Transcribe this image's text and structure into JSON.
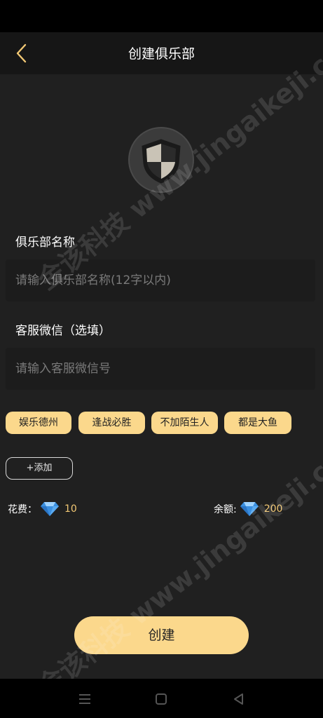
{
  "header": {
    "title": "创建俱乐部",
    "back_icon": "chevron-left-icon"
  },
  "avatar": {
    "icon": "shield-icon"
  },
  "club_name": {
    "label": "俱乐部名称",
    "placeholder": "请输入俱乐部名称(12字以内)",
    "value": ""
  },
  "wechat": {
    "label": "客服微信（选填）",
    "placeholder": "请输入客服微信号",
    "value": ""
  },
  "tags": [
    "娱乐德州",
    "逢战必胜",
    "不加陌生人",
    "都是大鱼"
  ],
  "add_tag_label": "+添加",
  "cost": {
    "label": "花费：",
    "value": "10",
    "icon": "diamond-icon"
  },
  "balance": {
    "label": "余额:",
    "value": "200",
    "icon": "diamond-icon"
  },
  "create_label": "创建",
  "watermark": "金该科技 www.jingaikeji.com",
  "colors": {
    "accent": "#fbd88c",
    "background": "#202020",
    "nav": "#161616",
    "value_text": "#f2c874"
  }
}
